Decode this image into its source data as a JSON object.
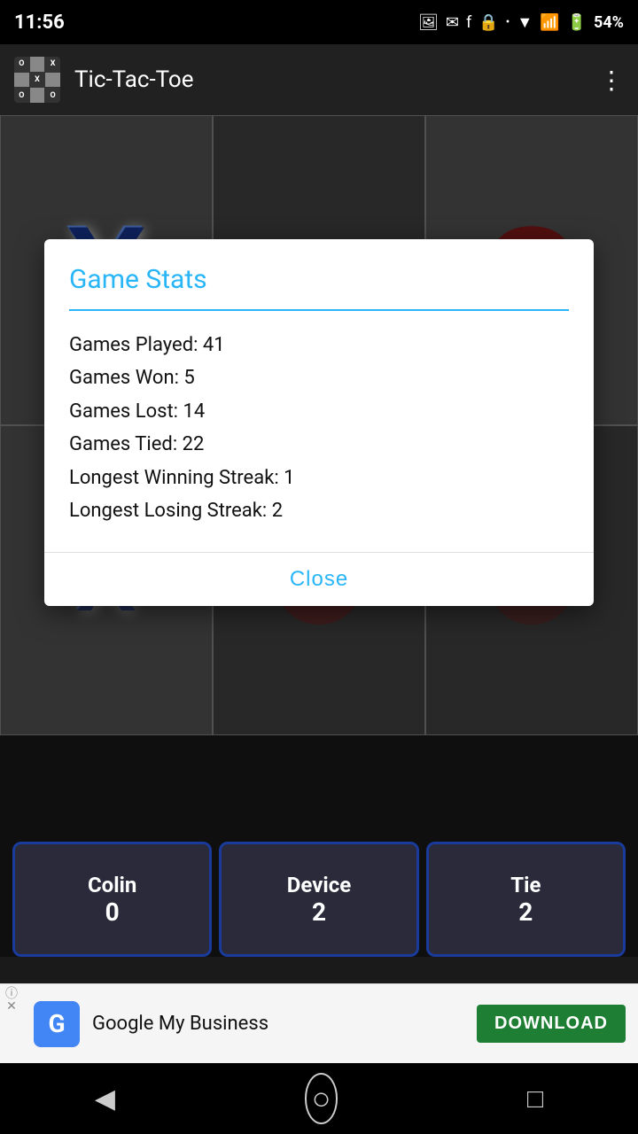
{
  "statusBar": {
    "time": "11:56",
    "batteryPercent": "54%"
  },
  "appBar": {
    "title": "Tic-Tac-Toe",
    "menuLabel": "⋮"
  },
  "dialog": {
    "title": "Game Stats",
    "stats": {
      "gamesPlayed": "Games Played: 41",
      "gamesWon": "Games Won: 5",
      "gamesLost": "Games Lost: 14",
      "gamesTied": "Games Tied: 22",
      "longestWinStreak": "Longest Winning Streak: 1",
      "longestLoseStreak": "Longest Losing Streak: 2"
    },
    "closeButton": "Close"
  },
  "scores": {
    "player1": {
      "name": "Colin",
      "score": "0"
    },
    "player2": {
      "name": "Device",
      "score": "2"
    },
    "tie": {
      "name": "Tie",
      "score": "2"
    }
  },
  "adBanner": {
    "appName": "Google My Business",
    "downloadLabel": "DOWNLOAD"
  },
  "navBar": {
    "backIcon": "◀",
    "homeIcon": "○",
    "recentsIcon": "□"
  }
}
